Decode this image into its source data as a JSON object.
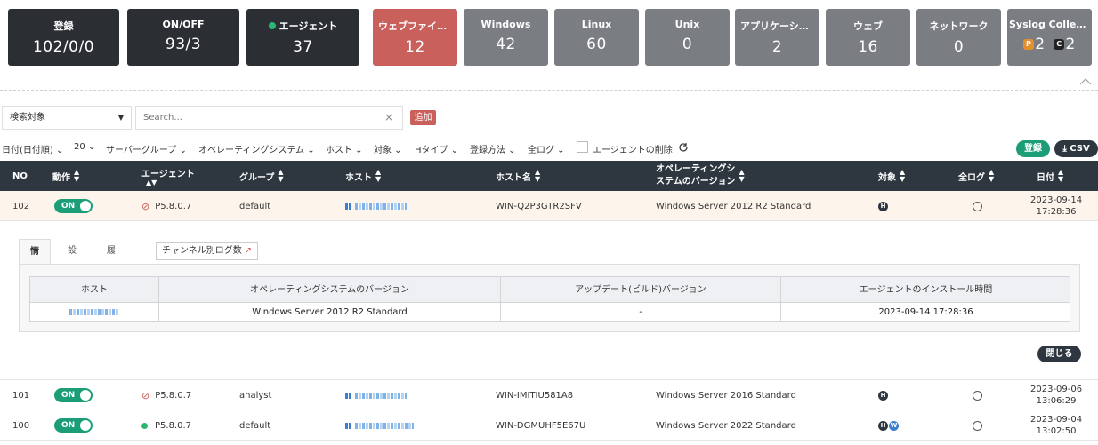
{
  "summary": [
    {
      "label": "登録",
      "value": "102/0/0",
      "style": "dark"
    },
    {
      "label": "ON/OFF",
      "value": "93/3",
      "style": "dark"
    },
    {
      "label": "エージェント",
      "value": "37",
      "style": "dark",
      "dot": true
    },
    {
      "label": "ウェブファイア…",
      "value": "12",
      "style": "red"
    },
    {
      "label": "Windows",
      "value": "42",
      "style": "gray"
    },
    {
      "label": "Linux",
      "value": "60",
      "style": "gray"
    },
    {
      "label": "Unix",
      "value": "0",
      "style": "gray"
    },
    {
      "label": "アプリケーション",
      "value": "2",
      "style": "gray"
    },
    {
      "label": "ウェブ",
      "value": "16",
      "style": "gray"
    },
    {
      "label": "ネットワーク",
      "value": "0",
      "style": "gray"
    }
  ],
  "syslog": {
    "label": "Syslog Collector",
    "p_badge": "P",
    "p_value": "2",
    "c_badge": "C",
    "c_value": "2"
  },
  "search": {
    "select_value": "検索対象",
    "placeholder": "Search...",
    "clear": "×",
    "add_label": "追加"
  },
  "filters": {
    "date": "日付(日付順)",
    "page_size": "20",
    "server_group": "サーバーグループ",
    "os": "オペレーティングシステム",
    "host": "ホスト",
    "target": "対象",
    "htype": "Hタイプ",
    "reg_method": "登録方法",
    "all_logs": "全ログ",
    "delete_agent": "エージェントの削除"
  },
  "actions": {
    "register": "登録",
    "csv": "CSV"
  },
  "table": {
    "headers": {
      "no": "NO",
      "action": "動作",
      "agent": "エージェント",
      "group": "グループ",
      "host": "ホスト",
      "hostname": "ホスト名",
      "os_line1": "オペレーティングシ",
      "os_line2": "ステムのバージョン",
      "target": "対象",
      "all_logs": "全ログ",
      "date": "日付"
    },
    "rows": [
      {
        "no": "102",
        "toggle": "ON",
        "agent_status": "blocked",
        "agent_version": "P5.8.0.7",
        "group": "default",
        "hostname": "WIN-Q2P3GTR2SFV",
        "os": "Windows Server 2012 R2 Standard",
        "targets": [
          "H"
        ],
        "date": "2023-09-14",
        "time": "17:28:36"
      },
      {
        "no": "101",
        "toggle": "ON",
        "agent_status": "blocked",
        "agent_version": "P5.8.0.7",
        "group": "analyst",
        "hostname": "WIN-IMITIU581A8",
        "os": "Windows Server 2016 Standard",
        "targets": [
          "H"
        ],
        "date": "2023-09-06",
        "time": "13:06:29"
      },
      {
        "no": "100",
        "toggle": "ON",
        "agent_status": "online",
        "agent_version": "P5.8.0.7",
        "group": "default",
        "hostname": "WIN-DGMUHF5E67U",
        "os": "Windows Server 2022 Standard",
        "targets": [
          "H",
          "W"
        ],
        "date": "2023-09-04",
        "time": "13:02:50"
      }
    ]
  },
  "detail": {
    "tabs": [
      "情報",
      "設定",
      "履歴"
    ],
    "channel_log": "チャンネル別ログ数",
    "headers": [
      "ホスト",
      "オペレーティングシステムのバージョン",
      "アップデート(ビルド)バージョン",
      "エージェントのインストール時間"
    ],
    "values": [
      "",
      "Windows Server 2012 R2 Standard",
      "-",
      "2023-09-14 17:28:36"
    ],
    "close": "閉じる"
  },
  "colors": {
    "dark": "#2b2f33",
    "gray": "#7a7d82",
    "red": "#c9605c",
    "green": "#1b9e77",
    "header": "#2e3640"
  }
}
